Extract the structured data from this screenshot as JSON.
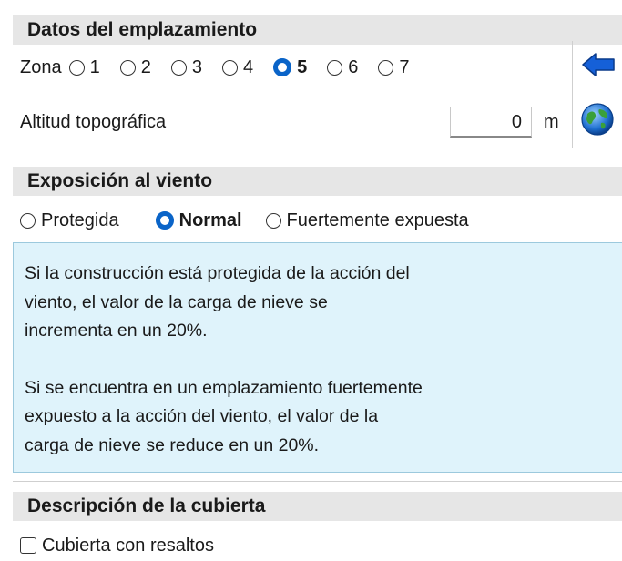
{
  "emplazamiento": {
    "title": "Datos del emplazamiento",
    "zona_label": "Zona",
    "zonas": [
      "1",
      "2",
      "3",
      "4",
      "5",
      "6",
      "7"
    ],
    "zona_selected": "5",
    "altitud_label": "Altitud topográfica",
    "altitud_value": "0",
    "altitud_unit": "m",
    "side_icons": [
      "arrow-left-icon",
      "globe-icon"
    ]
  },
  "exposicion": {
    "title": "Exposición al viento",
    "options": [
      "Protegida",
      "Normal",
      "Fuertemente expuesta"
    ],
    "selected": "Normal",
    "info_paragraph_1_lines": [
      "Si la construcción está protegida de la acción del",
      "viento, el valor de la carga de nieve se",
      "incrementa en un 20%."
    ],
    "info_paragraph_2_lines": [
      "Si se encuentra en un emplazamiento fuertemente",
      "expuesto a la acción del viento, el valor de la",
      "carga de nieve se reduce en un 20%."
    ]
  },
  "cubierta": {
    "title": "Descripción de la cubierta",
    "checkbox_label": "Cubierta con resaltos",
    "checkbox_checked": false
  },
  "colors": {
    "section_header_bg": "#e6e6e6",
    "info_bg": "#dff3fb",
    "radio_selected": "#0a64c8",
    "arrow_icon": "#1560d8"
  }
}
